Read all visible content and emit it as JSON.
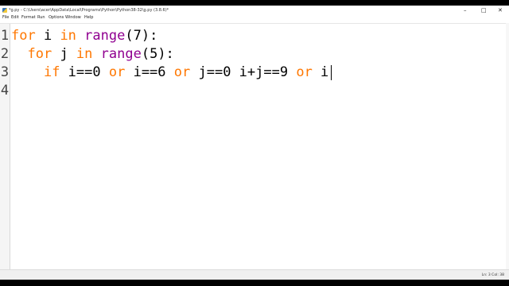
{
  "window": {
    "title": "*g.py - C:\\Users\\acer\\AppData\\Local\\Programs\\Python\\Python38-32\\g.py (3.8.6)*"
  },
  "menu": [
    "File",
    "Edit",
    "Format",
    "Run",
    "Options",
    "Window",
    "Help"
  ],
  "editor": {
    "line_numbers": [
      "1",
      "2",
      "3",
      "4"
    ],
    "lines": [
      {
        "tokens": [
          {
            "t": "for",
            "c": "kw"
          },
          {
            "t": " i ",
            "c": ""
          },
          {
            "t": "in",
            "c": "kw"
          },
          {
            "t": " ",
            "c": ""
          },
          {
            "t": "range",
            "c": "bi"
          },
          {
            "t": "(7):",
            "c": ""
          }
        ]
      },
      {
        "tokens": [
          {
            "t": "  ",
            "c": ""
          },
          {
            "t": "for",
            "c": "kw"
          },
          {
            "t": " j ",
            "c": ""
          },
          {
            "t": "in",
            "c": "kw"
          },
          {
            "t": " ",
            "c": ""
          },
          {
            "t": "range",
            "c": "bi"
          },
          {
            "t": "(5):",
            "c": ""
          }
        ]
      },
      {
        "tokens": [
          {
            "t": "    ",
            "c": ""
          },
          {
            "t": "if",
            "c": "kw"
          },
          {
            "t": " i==0 ",
            "c": ""
          },
          {
            "t": "or",
            "c": "kw"
          },
          {
            "t": " i==6 ",
            "c": ""
          },
          {
            "t": "or",
            "c": "kw"
          },
          {
            "t": " j==0 ",
            "c": ""
          },
          {
            "t": "i+j==9 ",
            "c": ""
          },
          {
            "t": "or",
            "c": "kw"
          },
          {
            "t": " i",
            "c": ""
          }
        ]
      },
      {
        "tokens": []
      }
    ]
  },
  "status": {
    "position": "Ln: 3   Col: 38"
  }
}
